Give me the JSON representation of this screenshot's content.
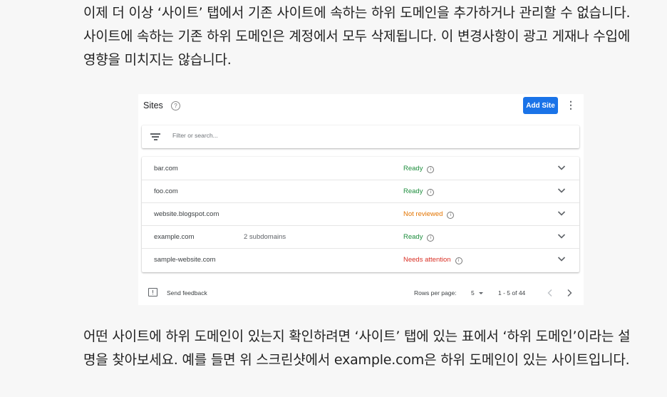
{
  "article": {
    "paragraph_top": "이제 더 이상 ‘사이트’ 탭에서 기존 사이트에 속하는 하위 도메인을 추가하거나 관리할 수 없습니다. 사이트에 속하는 기존 하위 도메인은 계정에서 모두 삭제됩니다. 이 변경사항이 광고 게재나 수입에 영향을 미치지는 않습니다.",
    "paragraph_bottom": "어떤 사이트에 하위 도메인이 있는지 확인하려면 ‘사이트’ 탭에 있는 표에서 ‘하위 도메인’이라는 설명을 찾아보세요. 예를 들면 위 스크린샷에서 example.com은 하위 도메인이 있는 사이트입니다."
  },
  "screenshot": {
    "header": {
      "title": "Sites",
      "help_icon": "help-circle-icon",
      "add_button": "Add Site",
      "more_icon": "more-vert-icon"
    },
    "filter": {
      "icon": "filter-list-icon",
      "placeholder": "Filter or search..."
    },
    "rows": [
      {
        "site": "bar.com",
        "subdomains": "",
        "status": "Ready",
        "status_color": "#1e8e3e"
      },
      {
        "site": "foo.com",
        "subdomains": "",
        "status": "Ready",
        "status_color": "#1e8e3e"
      },
      {
        "site": "website.blogspot.com",
        "subdomains": "",
        "status": "Not reviewed",
        "status_color": "#e37400"
      },
      {
        "site": "example.com",
        "subdomains": "2 subdomains",
        "status": "Ready",
        "status_color": "#1e8e3e"
      },
      {
        "site": "sample-website.com",
        "subdomains": "",
        "status": "Needs attention",
        "status_color": "#d93025"
      }
    ],
    "footer": {
      "feedback": "Send feedback",
      "rows_per_page_label": "Rows per page:",
      "rows_per_page_value": "5",
      "range": "1 - 5 of 44"
    },
    "colors": {
      "accent": "#1a73e8"
    }
  }
}
